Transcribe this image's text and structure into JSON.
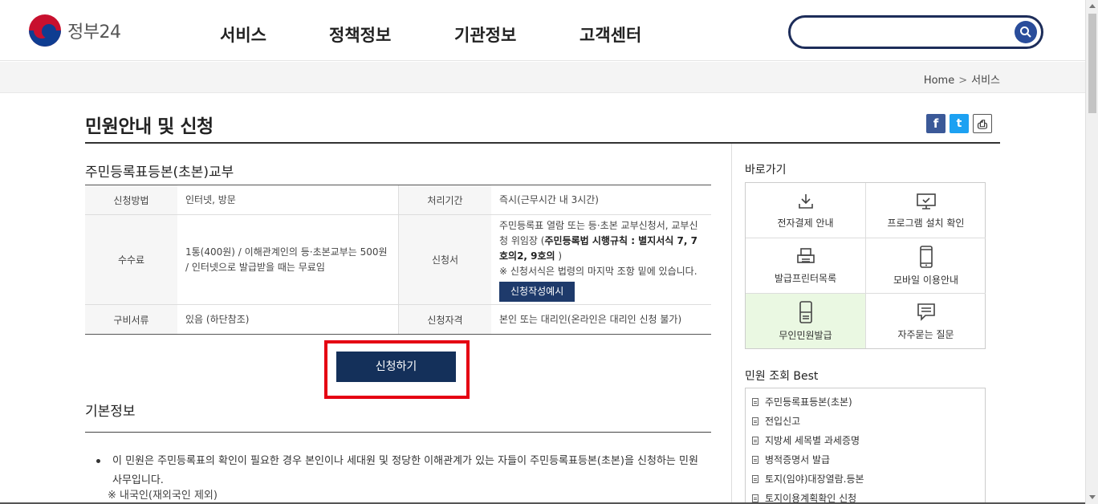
{
  "header": {
    "logo_text": "정부24",
    "nav": [
      "서비스",
      "정책정보",
      "기관정보",
      "고객센터"
    ],
    "search_placeholder": ""
  },
  "breadcrumb": {
    "home": "Home",
    "separator": ">",
    "current": "서비스"
  },
  "page": {
    "title": "민원안내 및 신청"
  },
  "share": {
    "facebook": "f",
    "twitter": "t",
    "print": "⎙"
  },
  "service": {
    "title": "주민등록표등본(초본)교부",
    "rows": [
      {
        "h1": "신청방법",
        "v1": "인터넷, 방문",
        "h2": "처리기간",
        "v2": "즉시(근무시간 내 3시간)"
      },
      {
        "h1": "수수료",
        "v1": "1통(400원) / 이해관계인의 등·초본교부는 500원 / 인터넷으로 발급받을 때는 무료임",
        "h2": "신청서",
        "v2_a": "주민등록표 열람 또는 등·초본 교부신청서, 교부신청 위임장 (",
        "v2_b": "주민등록법 시행규칙 : 별지서식 7, 7호의2, 9호의",
        "v2_c": " )",
        "v2_note": "※ 신청서식은 법령의 마지막 조항 밑에 있습니다.",
        "v2_button": "신청작성예시"
      },
      {
        "h1": "구비서류",
        "v1": "있음 (하단참조)",
        "h2": "신청자격",
        "v2": "본인 또는 대리인(온라인은 대리인 신청 불가)"
      }
    ],
    "apply_button": "신청하기"
  },
  "basic": {
    "title": "기본정보",
    "bullet": "이 민원은 주민등록표의 확인이 필요한 경우 본인이나 세대원 및 정당한 이해관계가 있는 자들이 주민등록표등본(초본)을 신청하는 민원사무입니다.",
    "note": "※ 내국인(재외국인 제외)"
  },
  "sidebar": {
    "quick_title": "바로가기",
    "quick": [
      {
        "label": "전자결제 안내",
        "icon": "download-icon"
      },
      {
        "label": "프로그램 설치 확인",
        "icon": "monitor-check-icon"
      },
      {
        "label": "발급프린터목록",
        "icon": "printer-icon"
      },
      {
        "label": "모바일 이용안내",
        "icon": "mobile-icon"
      },
      {
        "label": "무인민원발급",
        "icon": "kiosk-icon"
      },
      {
        "label": "자주묻는 질문",
        "icon": "chat-icon"
      }
    ],
    "best_title": "민원 조회 Best",
    "best": [
      "주민등록표등본(초본)",
      "전입신고",
      "지방세 세목별 과세증명",
      "병적증명서 발급",
      "토지(임야)대장열람.등본",
      "토지이용계획확인 신청"
    ]
  },
  "colors": {
    "accent_navy": "#14305a",
    "highlight_red": "#e50012",
    "active_green": "#eaf8e2"
  }
}
